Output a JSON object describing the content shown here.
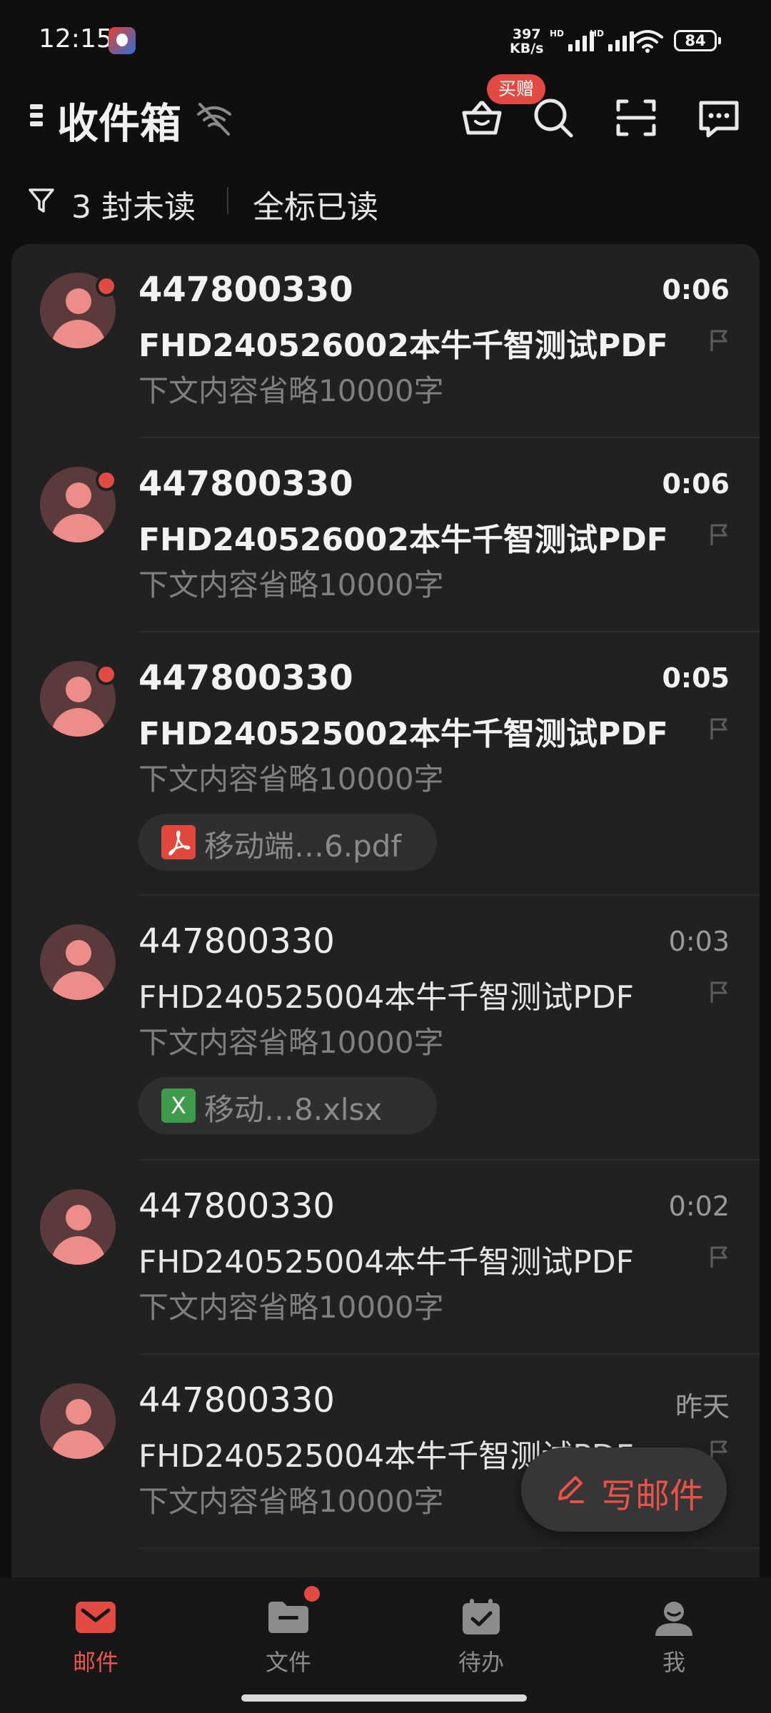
{
  "status_bar": {
    "time": "12:15",
    "net_speed_value": "397",
    "net_speed_unit": "KB/s",
    "sim1_label": "HD",
    "sim2_label": "HD",
    "battery": "84"
  },
  "header": {
    "title": "收件箱",
    "gift_badge": "买赠",
    "icons": [
      "menu-icon",
      "wifi-off-icon",
      "shopping-basket-icon",
      "search-icon",
      "scan-icon",
      "message-icon"
    ]
  },
  "filter": {
    "unread_label": "3 封未读",
    "mark_all_read": "全标已读"
  },
  "emails": [
    {
      "sender": "447800330",
      "subject": "FHD240526002本牛千智测试PDF",
      "preview": "下文内容省略10000字",
      "time": "0:06",
      "unread": true
    },
    {
      "sender": "447800330",
      "subject": "FHD240526002本牛千智测试PDF",
      "preview": "下文内容省略10000字",
      "time": "0:06",
      "unread": true
    },
    {
      "sender": "447800330",
      "subject": "FHD240525002本牛千智测试PDF",
      "preview": "下文内容省略10000字",
      "time": "0:05",
      "unread": true,
      "attachment": {
        "name": "移动端…6.pdf",
        "type": "pdf"
      }
    },
    {
      "sender": "447800330",
      "subject": "FHD240525004本牛千智测试PDF",
      "preview": "下文内容省略10000字",
      "time": "0:03",
      "unread": false,
      "attachment": {
        "name": "移动…8.xlsx",
        "type": "xlsx",
        "icon_letter": "X"
      }
    },
    {
      "sender": "447800330",
      "subject": "FHD240525004本牛千智测试PDF",
      "preview": "下文内容省略10000字",
      "time": "0:02",
      "unread": false
    },
    {
      "sender": "447800330",
      "subject": "FHD240525004本牛千智测试PDF",
      "preview": "下文内容省略10000字",
      "time": "昨天",
      "unread": false
    }
  ],
  "compose": {
    "label": "写邮件"
  },
  "bottom_nav": [
    {
      "label": "邮件",
      "active": true
    },
    {
      "label": "文件",
      "active": false,
      "badge": true
    },
    {
      "label": "待办",
      "active": false
    },
    {
      "label": "我",
      "active": false
    }
  ],
  "colors": {
    "accent": "#e24a44",
    "background": "#0f0f0f",
    "card": "#212121",
    "avatar_bg": "#5a3a3b",
    "avatar_fg": "#ec8d8a"
  }
}
